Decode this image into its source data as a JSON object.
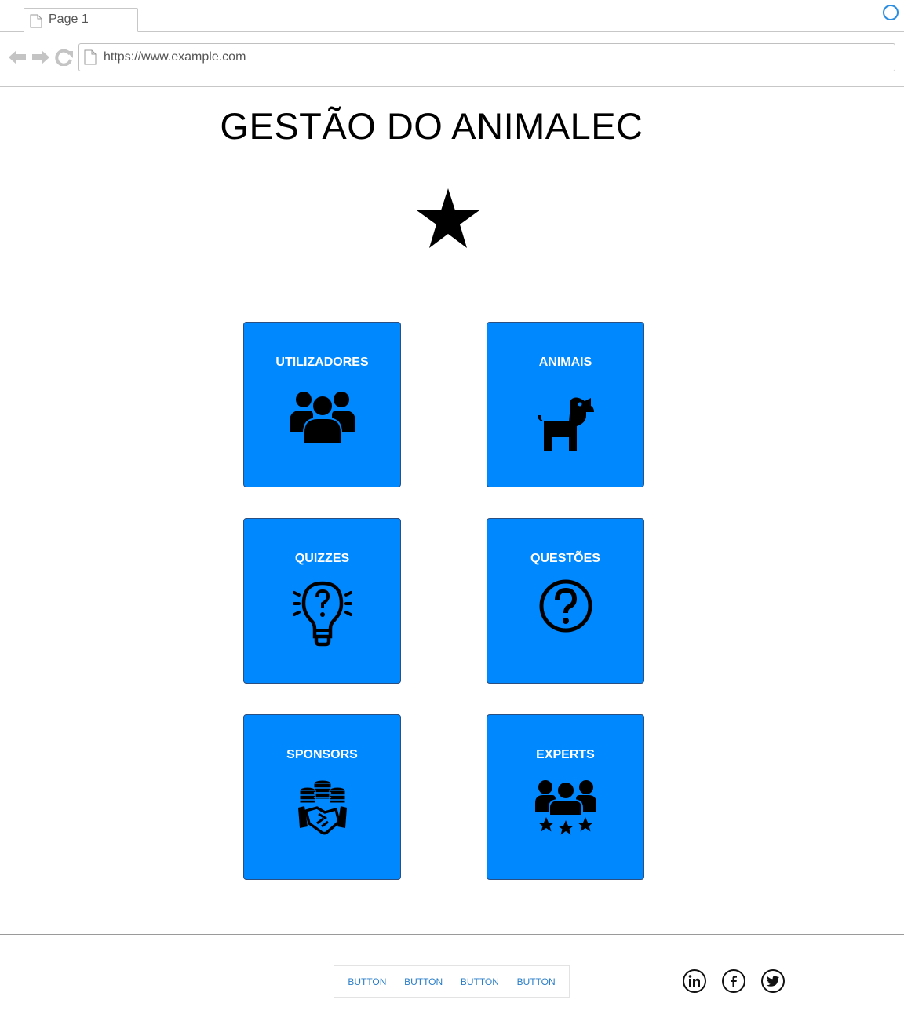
{
  "browser": {
    "tab_title": "Page 1",
    "url": "https://www.example.com"
  },
  "header": {
    "title": "GESTÃO DO ANIMALEC"
  },
  "tiles": [
    {
      "label": "UTILIZADORES",
      "icon": "users-icon"
    },
    {
      "label": "ANIMAIS",
      "icon": "dog-icon"
    },
    {
      "label": "QUIZZES",
      "icon": "lightbulb-question-icon"
    },
    {
      "label": "QUESTÕES",
      "icon": "question-circle-icon"
    },
    {
      "label": "SPONSORS",
      "icon": "handshake-coins-icon"
    },
    {
      "label": "EXPERTS",
      "icon": "group-stars-icon"
    }
  ],
  "footer": {
    "buttons": [
      "BUTTON",
      "BUTTON",
      "BUTTON",
      "BUTTON"
    ],
    "social": [
      "linkedin-icon",
      "facebook-icon",
      "twitter-icon"
    ]
  },
  "colors": {
    "tile_background": "#0088ff",
    "tile_text": "#ffffff",
    "link_blue": "#2a7ec8"
  }
}
